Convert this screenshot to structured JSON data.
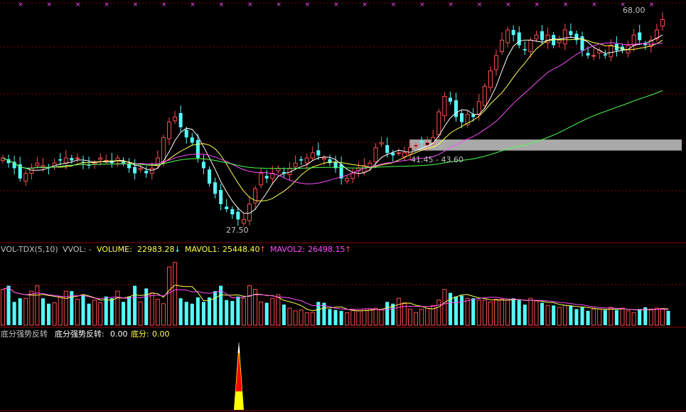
{
  "colors": {
    "up": "#ff4d4d",
    "down": "#54ffff",
    "ma5": "#ffffff",
    "ma10": "#ffff4d",
    "ma20": "#ff4dff",
    "ma60": "#4dff4d",
    "grid": "#8b0000",
    "label": "#c0c0c0",
    "highlight": "#a9a9a9"
  },
  "price_panel": {
    "high_label": "68.00",
    "low_label": "27.50",
    "range_label": "41.45 - 43.60"
  },
  "volume_panel": {
    "name": "VOL-TDX(5,10)",
    "vvol": "VVOL: -",
    "volume_label": "VOLUME:",
    "volume_value": "22983.28",
    "mavol1_label": "MAVOL1:",
    "mavol1_value": "25448.40",
    "mavol2_label": "MAVOL2:",
    "mavol2_value": "26498.15"
  },
  "indicator_panel": {
    "name": "底分强势反转",
    "item1_label": "底分强势反转:",
    "item1_value": "0.00",
    "item2_label": "底分:",
    "item2_value": "0.00"
  },
  "chart_data": {
    "type": "candlestick",
    "ylim": [
      25,
      70
    ],
    "closes": [
      40,
      39,
      38,
      36,
      37,
      38,
      39,
      38.5,
      38,
      39,
      39.5,
      40,
      39.5,
      40,
      39,
      38.5,
      39,
      40,
      39.5,
      39,
      40,
      39,
      38,
      37,
      38,
      37,
      38,
      40,
      44,
      47,
      48,
      46,
      44,
      43,
      40,
      38,
      35,
      33,
      31,
      30,
      29,
      28,
      28,
      31,
      34,
      37,
      36,
      37,
      38,
      37,
      38,
      39,
      39.5,
      40,
      41,
      40.5,
      40,
      39,
      38,
      36,
      36,
      37,
      38,
      38.5,
      39,
      42,
      43,
      41,
      40.5,
      41,
      41,
      42,
      42.5,
      43,
      43,
      44,
      49,
      52,
      51,
      48,
      47,
      48.5,
      48,
      51,
      54,
      57,
      60,
      63,
      65,
      64,
      62,
      61,
      63,
      64,
      63,
      64,
      62,
      63,
      65,
      64,
      63,
      61,
      60,
      60,
      61,
      60,
      62,
      61,
      61,
      62,
      64,
      63,
      62,
      63,
      65,
      67
    ],
    "volumes": [
      40,
      44,
      26,
      30,
      30,
      38,
      44,
      30,
      24,
      25,
      32,
      38,
      38,
      29,
      34,
      24,
      28,
      25,
      32,
      30,
      38,
      26,
      32,
      44,
      26,
      41,
      36,
      29,
      24,
      65,
      70,
      30,
      26,
      24,
      31,
      26,
      31,
      38,
      44,
      28,
      27,
      32,
      30,
      44,
      40,
      26,
      25,
      30,
      34,
      23,
      19,
      16,
      17,
      14,
      14,
      26,
      25,
      18,
      17,
      16,
      14,
      17,
      16,
      18,
      18,
      19,
      17,
      26,
      24,
      30,
      25,
      18,
      14,
      18,
      19,
      22,
      28,
      40,
      36,
      32,
      33,
      30,
      30,
      28,
      28,
      26,
      29,
      29,
      28,
      30,
      28,
      23,
      30,
      27,
      25,
      22,
      22,
      20,
      22,
      22,
      18,
      20,
      16,
      18,
      18,
      17,
      20,
      17,
      19,
      16,
      14,
      18,
      20,
      18,
      19,
      18,
      16
    ]
  }
}
